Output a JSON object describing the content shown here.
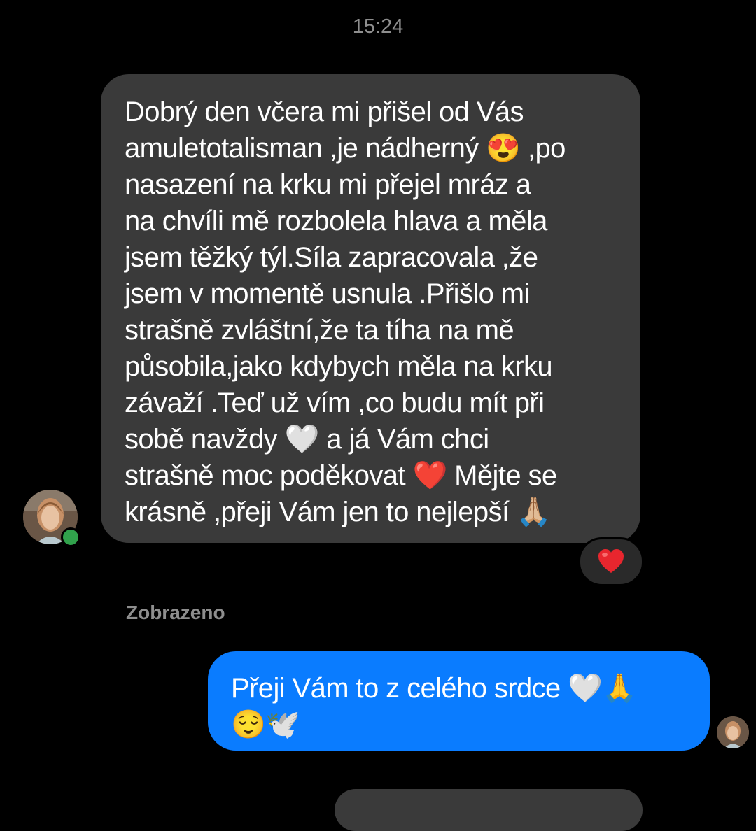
{
  "timestamp": "15:24",
  "incoming_message": {
    "text": "Dobrý den včera mi přišel od Vás\namuletotalisman ,je nádherný 😍 ,po\nnasazení na krku mi přejel mráz a\nna chvíli mě rozbolela hlava a měla\njsem těžký týl.Síla zapracovala ,že\njsem v momentě usnula .Přišlo mi\nstrašně zvláštní,že ta tíha na mě\npůsobila,jako kdybych měla na krku\nzávaží .Teď už vím ,co budu mít při\nsobě navždy 🤍 a já Vám chci\nstrašně moc poděkovat ❤️ Mějte se\nkrásně ,přeji Vám jen to nejlepší 🙏🏼",
    "reaction": "heart-emoji",
    "sender_online": true
  },
  "seen_label": "Zobrazeno",
  "outgoing_message": {
    "text": "Přeji Vám to z celého srdce 🤍🙏\n😌🕊️"
  },
  "colors": {
    "background": "#000000",
    "incoming_bubble": "#3a3a3a",
    "outgoing_bubble": "#0a7cff",
    "muted_text": "#8e8e8e",
    "online": "#31a24c",
    "heart": "#e8262e"
  }
}
